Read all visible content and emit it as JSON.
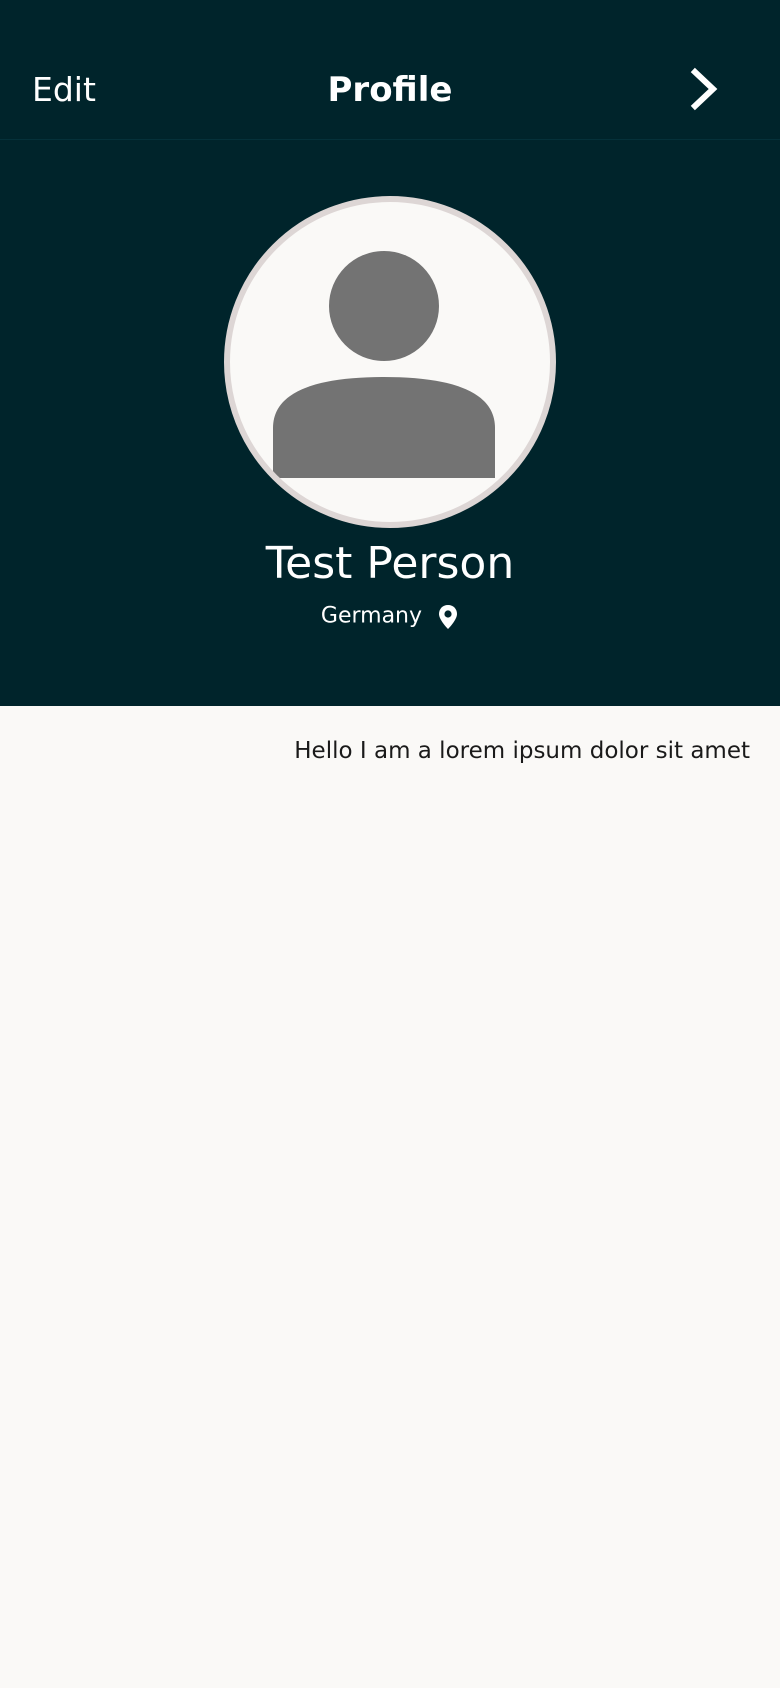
{
  "header": {
    "edit_label": "Edit",
    "title": "Profile",
    "next_icon": "chevron-right-icon"
  },
  "profile": {
    "avatar_icon": "person-icon",
    "name": "Test Person",
    "location": "Germany",
    "location_icon": "map-pin-icon",
    "bio": "Hello I am a lorem ipsum dolor sit amet"
  },
  "colors": {
    "header_background": "#00242b",
    "page_background": "#faf9f7",
    "avatar_placeholder": "#737373",
    "avatar_border": "#ddd6d5",
    "text_light": "#ffffff",
    "text_dark": "#1a1a1a"
  }
}
